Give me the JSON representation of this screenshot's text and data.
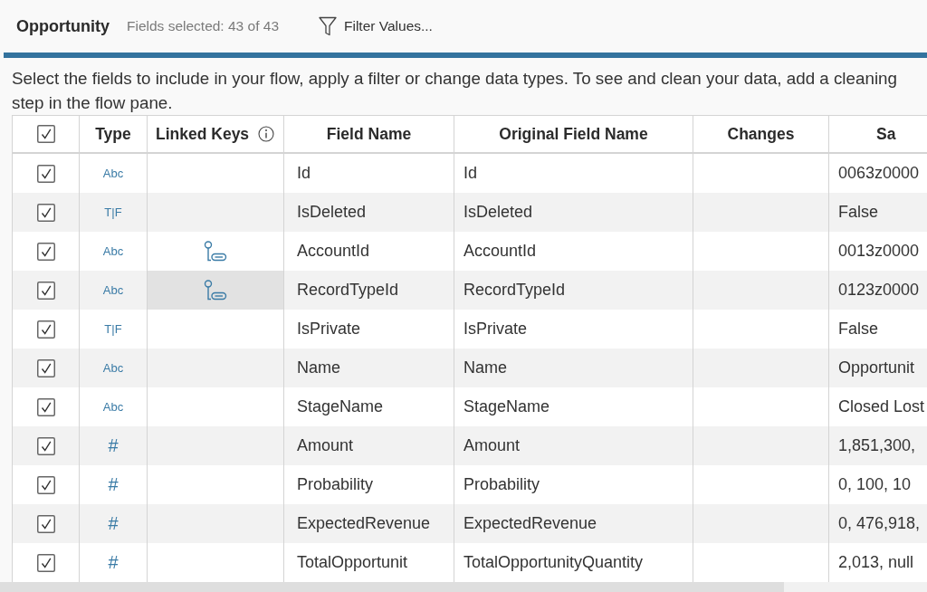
{
  "header": {
    "title": "Opportunity",
    "fields_selected": "Fields selected: 43 of 43",
    "filter_button": "Filter Values..."
  },
  "description": "Select the fields to include in your flow, apply a filter or change data types. To see and clean your data, add a cleaning step in the flow pane.",
  "table": {
    "select_all_checked": true,
    "columns": [
      {
        "label": "Type",
        "info": false
      },
      {
        "label": "Linked Keys",
        "info": true
      },
      {
        "label": "Field Name",
        "info": false
      },
      {
        "label": "Original Field Name",
        "info": false
      },
      {
        "label": "Changes",
        "info": false
      },
      {
        "label": "Sa",
        "info": false
      }
    ],
    "rows": [
      {
        "checked": true,
        "type": {
          "kind": "string",
          "label": "Abc"
        },
        "linked_key": false,
        "linked_key_hovered": false,
        "field_name": "Id",
        "original_field_name": "Id",
        "sample": "0063z0000"
      },
      {
        "checked": true,
        "type": {
          "kind": "boolean",
          "label": "T|F"
        },
        "linked_key": false,
        "linked_key_hovered": false,
        "field_name": "IsDeleted",
        "original_field_name": "IsDeleted",
        "sample": "False"
      },
      {
        "checked": true,
        "type": {
          "kind": "string",
          "label": "Abc"
        },
        "linked_key": true,
        "linked_key_hovered": false,
        "field_name": "AccountId",
        "original_field_name": "AccountId",
        "sample": "0013z0000"
      },
      {
        "checked": true,
        "type": {
          "kind": "string",
          "label": "Abc"
        },
        "linked_key": true,
        "linked_key_hovered": true,
        "field_name": "RecordTypeId",
        "original_field_name": "RecordTypeId",
        "sample": "0123z0000"
      },
      {
        "checked": true,
        "type": {
          "kind": "boolean",
          "label": "T|F"
        },
        "linked_key": false,
        "linked_key_hovered": false,
        "field_name": "IsPrivate",
        "original_field_name": "IsPrivate",
        "sample": "False"
      },
      {
        "checked": true,
        "type": {
          "kind": "string",
          "label": "Abc"
        },
        "linked_key": false,
        "linked_key_hovered": false,
        "field_name": "Name",
        "original_field_name": "Name",
        "sample": "Opportunit"
      },
      {
        "checked": true,
        "type": {
          "kind": "string",
          "label": "Abc"
        },
        "linked_key": false,
        "linked_key_hovered": false,
        "field_name": "StageName",
        "original_field_name": "StageName",
        "sample": "Closed Lost"
      },
      {
        "checked": true,
        "type": {
          "kind": "number",
          "label": "#"
        },
        "linked_key": false,
        "linked_key_hovered": false,
        "field_name": "Amount",
        "original_field_name": "Amount",
        "sample": "1,851,300,"
      },
      {
        "checked": true,
        "type": {
          "kind": "number",
          "label": "#"
        },
        "linked_key": false,
        "linked_key_hovered": false,
        "field_name": "Probability",
        "original_field_name": "Probability",
        "sample": "0, 100, 10"
      },
      {
        "checked": true,
        "type": {
          "kind": "number",
          "label": "#"
        },
        "linked_key": false,
        "linked_key_hovered": false,
        "field_name": "ExpectedRevenue",
        "original_field_name": "ExpectedRevenue",
        "sample": "0, 476,918,"
      },
      {
        "checked": true,
        "type": {
          "kind": "number",
          "label": "#"
        },
        "linked_key": false,
        "linked_key_hovered": false,
        "field_name": "TotalOpportunit",
        "original_field_name": "TotalOpportunityQuantity",
        "sample": "2,013, null"
      }
    ]
  }
}
